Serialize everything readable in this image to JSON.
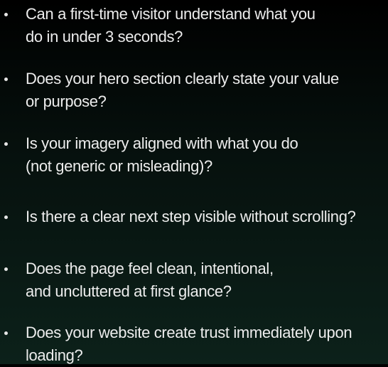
{
  "checklist": {
    "items": [
      {
        "lines": [
          "Can a first-time visitor understand what you",
          "do in under 3 seconds?"
        ]
      },
      {
        "lines": [
          "Does your hero section clearly state your value",
          "or purpose?"
        ]
      },
      {
        "lines": [
          "Is your imagery aligned with what you do",
          "(not generic or misleading)?"
        ]
      },
      {
        "lines": [
          "Is there a clear next step visible without scrolling?"
        ]
      },
      {
        "lines": [
          "Does the page feel clean, intentional,",
          "and uncluttered at first glance?"
        ]
      },
      {
        "lines": [
          "Does your website create trust immediately upon",
          "loading?"
        ]
      }
    ]
  },
  "colors": {
    "text": "#ededed",
    "background_top": "#000000",
    "background_bottom": "#0c211a"
  }
}
